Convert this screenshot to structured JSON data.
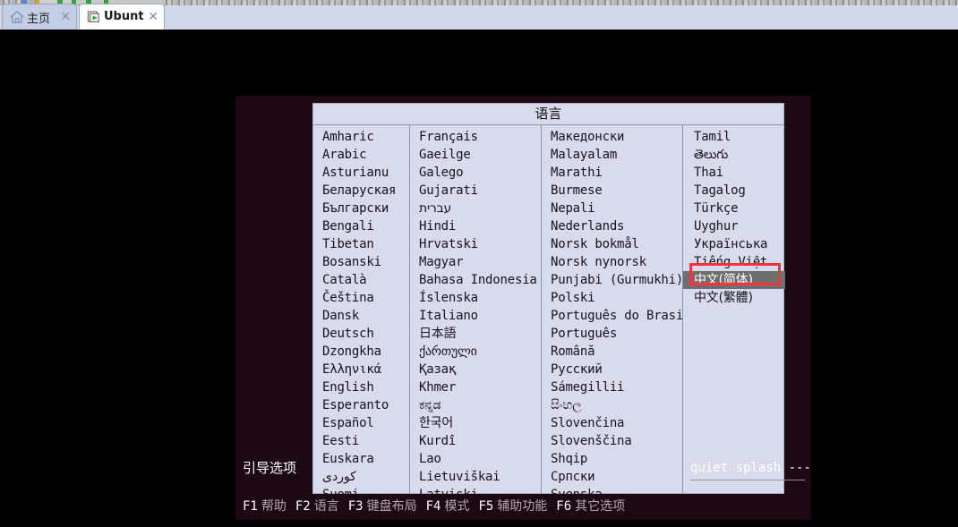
{
  "browser": {
    "tabs": [
      {
        "label": "主页",
        "icon": "home-icon",
        "close": "✕",
        "active": false
      },
      {
        "label": "Ubuntu",
        "icon": "vm-icon",
        "close": "✕",
        "active": true
      }
    ]
  },
  "installer": {
    "dialog_title": "语言",
    "boot_options_label": "引导选项",
    "cmdline": "quiet splash ---",
    "selected_language": "中文(简体)",
    "selection_highlight_color": "#f5343c",
    "selection_row_bg": "#6e6e6e",
    "dialog_bg": "#d8dbec",
    "screen_bg": "#1d0913",
    "columns": [
      {
        "items": [
          "Amharic",
          "Arabic",
          "Asturianu",
          "Беларуская",
          "Български",
          "Bengali",
          "Tibetan",
          "Bosanski",
          "Català",
          "Čeština",
          "Dansk",
          "Deutsch",
          "Dzongkha",
          "Ελληνικά",
          "English",
          "Esperanto",
          "Español",
          "Eesti",
          "Euskara",
          "کوردی",
          "Suomi"
        ]
      },
      {
        "items": [
          "Français",
          "Gaeilge",
          "Galego",
          "Gujarati",
          "עברית",
          "Hindi",
          "Hrvatski",
          "Magyar",
          "Bahasa Indonesia",
          "Íslenska",
          "Italiano",
          "日本語",
          "ქართული",
          "Қазақ",
          "Khmer",
          "ಕನ್ನಡ",
          "한국어",
          "Kurdî",
          "Lao",
          "Lietuviškai",
          "Latviski"
        ]
      },
      {
        "items": [
          "Македонски",
          "Malayalam",
          "Marathi",
          "Burmese",
          "Nepali",
          "Nederlands",
          "Norsk bokmål",
          "Norsk nynorsk",
          "Punjabi (Gurmukhi)",
          "Polski",
          "Português do Brasil",
          "Português",
          "Română",
          "Русский",
          "Sámegillii",
          "සිංහල",
          "Slovenčina",
          "Slovenščina",
          "Shqip",
          "Српски",
          "Svenska"
        ]
      },
      {
        "items": [
          "Tamil",
          "తెలుగు",
          "Thai",
          "Tagalog",
          "Türkçe",
          "Uyghur",
          "Українська",
          "Tiếng Việt",
          "中文(简体)",
          "中文(繁體)"
        ]
      }
    ],
    "function_keys": [
      {
        "key": "F1",
        "desc": "帮助"
      },
      {
        "key": "F2",
        "desc": "语言"
      },
      {
        "key": "F3",
        "desc": "键盘布局"
      },
      {
        "key": "F4",
        "desc": "模式"
      },
      {
        "key": "F5",
        "desc": "辅助功能"
      },
      {
        "key": "F6",
        "desc": "其它选项"
      }
    ]
  }
}
